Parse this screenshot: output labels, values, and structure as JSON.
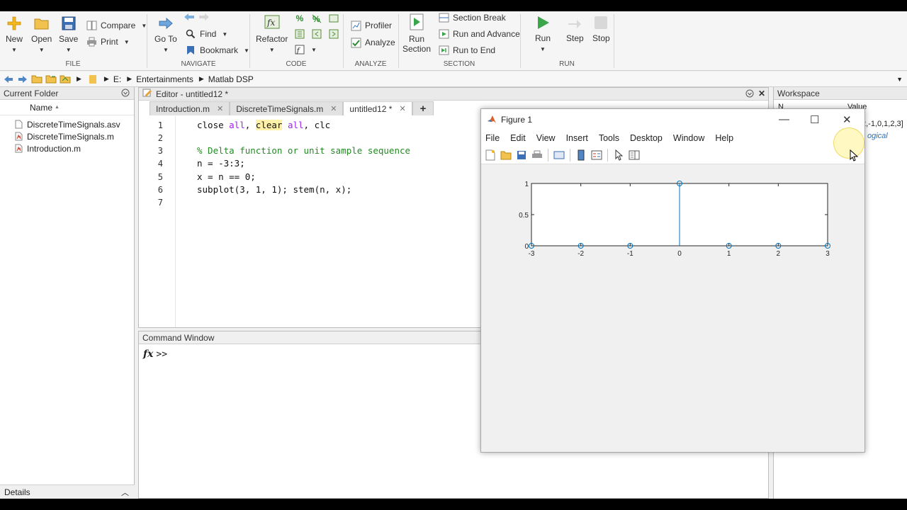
{
  "toolstrip": {
    "file": {
      "group_label": "FILE",
      "new": "New",
      "open": "Open",
      "save": "Save",
      "compare": "Compare",
      "print": "Print"
    },
    "navigate": {
      "group_label": "NAVIGATE",
      "go_to": "Go To",
      "find": "Find",
      "bookmark": "Bookmark"
    },
    "code": {
      "group_label": "CODE",
      "refactor": "Refactor",
      "percent_icon": "%"
    },
    "analyze": {
      "group_label": "ANALYZE",
      "profiler": "Profiler",
      "analyze": "Analyze"
    },
    "section": {
      "group_label": "SECTION",
      "run_section_1": "Run",
      "run_section_2": "Section",
      "section_break": "Section Break",
      "run_and_advance": "Run and Advance",
      "run_to_end": "Run to End"
    },
    "run": {
      "group_label": "RUN",
      "run": "Run",
      "step": "Step",
      "stop": "Stop"
    }
  },
  "address": {
    "path": [
      "E:",
      "Entertainments",
      "Matlab DSP"
    ]
  },
  "current_folder": {
    "title": "Current Folder",
    "column_name": "Name",
    "sort_indicator": "▲",
    "files": [
      {
        "name": "DiscreteTimeSignals.asv",
        "icon": "asv-file-icon"
      },
      {
        "name": "DiscreteTimeSignals.m",
        "icon": "m-file-icon"
      },
      {
        "name": "Introduction.m",
        "icon": "m-file-icon"
      }
    ],
    "details_label": "Details"
  },
  "editor": {
    "title": "Editor - untitled12 *",
    "tabs": [
      {
        "label": "Introduction.m",
        "active": false
      },
      {
        "label": "DiscreteTimeSignals.m",
        "active": false
      },
      {
        "label": "untitled12 *",
        "active": true
      }
    ],
    "new_tab_label": "+",
    "line_numbers": [
      "1",
      "2",
      "3",
      "4",
      "5",
      "6",
      "7"
    ],
    "lines": {
      "l1": {
        "a": "close ",
        "b": "all",
        "c": ", ",
        "d": "clear",
        "e": " ",
        "f": "all",
        "g": ", clc"
      },
      "l3": "% Delta function or unit sample sequence",
      "l4": "n = -3:3;",
      "l5": "x = n == 0;",
      "l6": "subplot(3, 1, 1); stem(n, x);"
    }
  },
  "command_window": {
    "title": "Command Window",
    "fx": "fx",
    "prompt": ">>"
  },
  "workspace": {
    "title": "Workspace",
    "header_name": "N",
    "header_value": "Value",
    "row1_value": "2,-1,0,1,2,3]",
    "row2_value": "ogical"
  },
  "figure": {
    "title": "Figure 1",
    "menu": [
      "File",
      "Edit",
      "View",
      "Insert",
      "Tools",
      "Desktop",
      "Window",
      "Help"
    ],
    "win_min": "—",
    "win_max": "☐",
    "win_close": "✕"
  },
  "chart_data": {
    "type": "stem",
    "x": [
      -3,
      -2,
      -1,
      0,
      1,
      2,
      3
    ],
    "y": [
      0,
      0,
      0,
      1,
      0,
      0,
      0
    ],
    "xlim": [
      -3,
      3
    ],
    "ylim": [
      0,
      1
    ],
    "xticks": [
      "-3",
      "-2",
      "-1",
      "0",
      "1",
      "2",
      "3"
    ],
    "yticks": [
      "0",
      "0.5",
      "1"
    ],
    "marker": "circle",
    "color": "#0072bd",
    "grid": false,
    "title": "",
    "xlabel": "",
    "ylabel": ""
  }
}
